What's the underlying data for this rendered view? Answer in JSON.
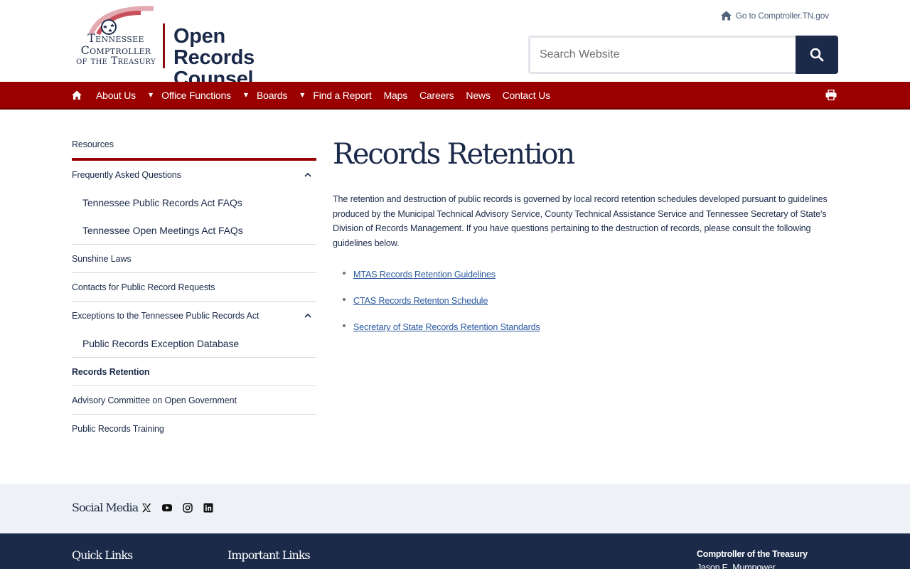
{
  "header": {
    "logo": {
      "seal_lines": [
        "Tennessee",
        "Comptroller",
        "of the Treasury"
      ],
      "title_line1": "Open Records",
      "title_line2": "Counsel"
    },
    "comptroller_link": "Go to Comptroller.TN.gov",
    "search": {
      "placeholder": "Search Website"
    }
  },
  "nav": {
    "items": [
      "About Us",
      "Office Functions",
      "Boards",
      "Find a Report",
      "Maps",
      "Careers",
      "News",
      "Contact Us"
    ]
  },
  "sidebar": {
    "heading": "Resources",
    "faq": "Frequently Asked Questions",
    "faq_sub": [
      "Tennessee Public Records Act FAQs",
      "Tennessee Open Meetings Act FAQs"
    ],
    "sunshine": "Sunshine Laws",
    "contacts": "Contacts for Public Record Requests",
    "exceptions": "Exceptions to the Tennessee Public Records Act",
    "exceptions_sub": [
      "Public Records Exception Database"
    ],
    "records_retention": "Records Retention",
    "advisory": "Advisory Committee on Open Government",
    "training": "Public Records Training"
  },
  "main": {
    "title": "Records Retention",
    "intro": "The retention and destruction of public records is governed by local record retention schedules developed pursuant to guidelines produced by the Municipal Technical Advisory Service, County Technical Assistance Service and Tennessee Secretary of State's Division of Records Management. If you have questions pertaining to the destruction of records, please consult the following guidelines below.",
    "links": [
      "MTAS Records Retention Guidelines",
      "CTAS Records Retenton Schedule",
      "Secretary of State Records Retention Standards"
    ]
  },
  "social": {
    "title": "Social Media",
    "icons": [
      "x-icon",
      "youtube-icon",
      "instagram-icon",
      "linkedin-icon"
    ]
  },
  "footer": {
    "quick_links": "Quick Links",
    "important_links": "Important Links",
    "org": "Comptroller of the Treasury",
    "name": "Jason E. Mumpower"
  },
  "colors": {
    "navy": "#1b2a49",
    "nav_red": "#9a0000",
    "link_blue": "#2b5aa0",
    "social_bg": "#eef1f5"
  }
}
